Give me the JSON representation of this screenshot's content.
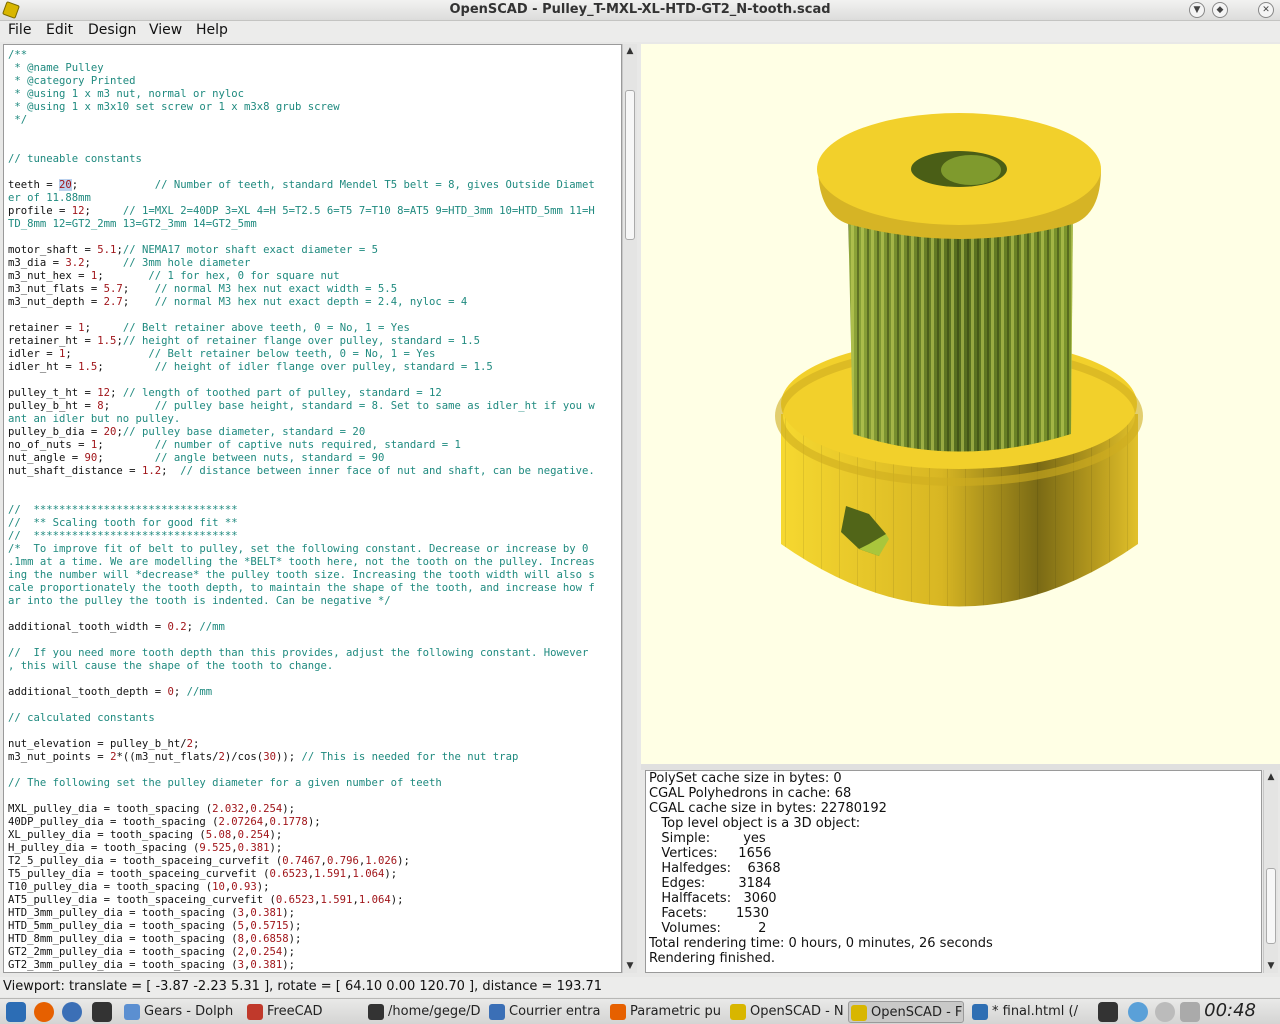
{
  "window": {
    "title": "OpenSCAD - Pulley_T-MXL-XL-HTD-GT2_N-tooth.scad"
  },
  "menu": [
    "File",
    "Edit",
    "Design",
    "View",
    "Help"
  ],
  "editor": {
    "lines": [
      [
        [
          "c",
          "/**"
        ]
      ],
      [
        [
          "c",
          " * @name Pulley"
        ]
      ],
      [
        [
          "c",
          " * @category Printed"
        ]
      ],
      [
        [
          "c",
          " * @using 1 x m3 nut, normal or nyloc"
        ]
      ],
      [
        [
          "c",
          " * @using 1 x m3x10 set screw or 1 x m3x8 grub screw"
        ]
      ],
      [
        [
          "c",
          " */"
        ]
      ],
      [],
      [],
      [
        [
          "c",
          "// tuneable constants"
        ]
      ],
      [],
      [
        [
          "t",
          "teeth = "
        ],
        [
          "s",
          "20"
        ],
        [
          "t",
          ";            "
        ],
        [
          "c",
          "// Number of teeth, standard Mendel T5 belt = 8, gives Outside Diamet"
        ]
      ],
      [
        [
          "c",
          "er of 11.88mm"
        ]
      ],
      [
        [
          "t",
          "profile = "
        ],
        [
          "n",
          "12"
        ],
        [
          "t",
          ";     "
        ],
        [
          "c",
          "// 1=MXL 2=40DP 3=XL 4=H 5=T2.5 6=T5 7=T10 8=AT5 9=HTD_3mm 10=HTD_5mm 11=H"
        ]
      ],
      [
        [
          "c",
          "TD_8mm 12=GT2_2mm 13=GT2_3mm 14=GT2_5mm"
        ]
      ],
      [],
      [
        [
          "t",
          "motor_shaft = "
        ],
        [
          "n",
          "5.1"
        ],
        [
          "t",
          ";"
        ],
        [
          "c",
          "// NEMA17 motor shaft exact diameter = 5"
        ]
      ],
      [
        [
          "t",
          "m3_dia = "
        ],
        [
          "n",
          "3.2"
        ],
        [
          "t",
          ";     "
        ],
        [
          "c",
          "// 3mm hole diameter"
        ]
      ],
      [
        [
          "t",
          "m3_nut_hex = "
        ],
        [
          "n",
          "1"
        ],
        [
          "t",
          ";       "
        ],
        [
          "c",
          "// 1 for hex, 0 for square nut"
        ]
      ],
      [
        [
          "t",
          "m3_nut_flats = "
        ],
        [
          "n",
          "5.7"
        ],
        [
          "t",
          ";    "
        ],
        [
          "c",
          "// normal M3 hex nut exact width = 5.5"
        ]
      ],
      [
        [
          "t",
          "m3_nut_depth = "
        ],
        [
          "n",
          "2.7"
        ],
        [
          "t",
          ";    "
        ],
        [
          "c",
          "// normal M3 hex nut exact depth = 2.4, nyloc = 4"
        ]
      ],
      [],
      [
        [
          "t",
          "retainer = "
        ],
        [
          "n",
          "1"
        ],
        [
          "t",
          ";     "
        ],
        [
          "c",
          "// Belt retainer above teeth, 0 = No, 1 = Yes"
        ]
      ],
      [
        [
          "t",
          "retainer_ht = "
        ],
        [
          "n",
          "1.5"
        ],
        [
          "t",
          ";"
        ],
        [
          "c",
          "// height of retainer flange over pulley, standard = 1.5"
        ]
      ],
      [
        [
          "t",
          "idler = "
        ],
        [
          "n",
          "1"
        ],
        [
          "t",
          ";            "
        ],
        [
          "c",
          "// Belt retainer below teeth, 0 = No, 1 = Yes"
        ]
      ],
      [
        [
          "t",
          "idler_ht = "
        ],
        [
          "n",
          "1.5"
        ],
        [
          "t",
          ";        "
        ],
        [
          "c",
          "// height of idler flange over pulley, standard = 1.5"
        ]
      ],
      [],
      [
        [
          "t",
          "pulley_t_ht = "
        ],
        [
          "n",
          "12"
        ],
        [
          "t",
          "; "
        ],
        [
          "c",
          "// length of toothed part of pulley, standard = 12"
        ]
      ],
      [
        [
          "t",
          "pulley_b_ht = "
        ],
        [
          "n",
          "8"
        ],
        [
          "t",
          ";       "
        ],
        [
          "c",
          "// pulley base height, standard = 8. Set to same as idler_ht if you w"
        ]
      ],
      [
        [
          "c",
          "ant an idler but no pulley."
        ]
      ],
      [
        [
          "t",
          "pulley_b_dia = "
        ],
        [
          "n",
          "20"
        ],
        [
          "t",
          ";"
        ],
        [
          "c",
          "// pulley base diameter, standard = 20"
        ]
      ],
      [
        [
          "t",
          "no_of_nuts = "
        ],
        [
          "n",
          "1"
        ],
        [
          "t",
          ";        "
        ],
        [
          "c",
          "// number of captive nuts required, standard = 1"
        ]
      ],
      [
        [
          "t",
          "nut_angle = "
        ],
        [
          "n",
          "90"
        ],
        [
          "t",
          ";        "
        ],
        [
          "c",
          "// angle between nuts, standard = 90"
        ]
      ],
      [
        [
          "t",
          "nut_shaft_distance = "
        ],
        [
          "n",
          "1.2"
        ],
        [
          "t",
          ";  "
        ],
        [
          "c",
          "// distance between inner face of nut and shaft, can be negative."
        ]
      ],
      [],
      [],
      [
        [
          "c",
          "//  ********************************"
        ]
      ],
      [
        [
          "c",
          "//  ** Scaling tooth for good fit **"
        ]
      ],
      [
        [
          "c",
          "//  ********************************"
        ]
      ],
      [
        [
          "c",
          "/*  To improve fit of belt to pulley, set the following constant. Decrease or increase by 0"
        ]
      ],
      [
        [
          "c",
          ".1mm at a time. We are modelling the *BELT* tooth here, not the tooth on the pulley. Increas"
        ]
      ],
      [
        [
          "c",
          "ing the number will *decrease* the pulley tooth size. Increasing the tooth width will also s"
        ]
      ],
      [
        [
          "c",
          "cale proportionately the tooth depth, to maintain the shape of the tooth, and increase how f"
        ]
      ],
      [
        [
          "c",
          "ar into the pulley the tooth is indented. Can be negative */"
        ]
      ],
      [],
      [
        [
          "t",
          "additional_tooth_width = "
        ],
        [
          "n",
          "0.2"
        ],
        [
          "t",
          "; "
        ],
        [
          "c",
          "//mm"
        ]
      ],
      [],
      [
        [
          "c",
          "//  If you need more tooth depth than this provides, adjust the following constant. However"
        ]
      ],
      [
        [
          "c",
          ", this will cause the shape of the tooth to change."
        ]
      ],
      [],
      [
        [
          "t",
          "additional_tooth_depth = "
        ],
        [
          "n",
          "0"
        ],
        [
          "t",
          "; "
        ],
        [
          "c",
          "//mm"
        ]
      ],
      [],
      [
        [
          "c",
          "// calculated constants"
        ]
      ],
      [],
      [
        [
          "t",
          "nut_elevation = pulley_b_ht/"
        ],
        [
          "n",
          "2"
        ],
        [
          "t",
          ";"
        ]
      ],
      [
        [
          "t",
          "m3_nut_points = "
        ],
        [
          "n",
          "2"
        ],
        [
          "t",
          "*((m3_nut_flats/"
        ],
        [
          "n",
          "2"
        ],
        [
          "t",
          ")/cos("
        ],
        [
          "n",
          "30"
        ],
        [
          "t",
          ")); "
        ],
        [
          "c",
          "// This is needed for the nut trap"
        ]
      ],
      [],
      [
        [
          "c",
          "// The following set the pulley diameter for a given number of teeth"
        ]
      ],
      [],
      [
        [
          "t",
          "MXL_pulley_dia = tooth_spacing ("
        ],
        [
          "n",
          "2.032"
        ],
        [
          "t",
          ","
        ],
        [
          "n",
          "0.254"
        ],
        [
          "t",
          ");"
        ]
      ],
      [
        [
          "t",
          "40DP_pulley_dia = tooth_spacing ("
        ],
        [
          "n",
          "2.07264"
        ],
        [
          "t",
          ","
        ],
        [
          "n",
          "0.1778"
        ],
        [
          "t",
          ");"
        ]
      ],
      [
        [
          "t",
          "XL_pulley_dia = tooth_spacing ("
        ],
        [
          "n",
          "5.08"
        ],
        [
          "t",
          ","
        ],
        [
          "n",
          "0.254"
        ],
        [
          "t",
          ");"
        ]
      ],
      [
        [
          "t",
          "H_pulley_dia = tooth_spacing ("
        ],
        [
          "n",
          "9.525"
        ],
        [
          "t",
          ","
        ],
        [
          "n",
          "0.381"
        ],
        [
          "t",
          ");"
        ]
      ],
      [
        [
          "t",
          "T2_5_pulley_dia = tooth_spaceing_curvefit ("
        ],
        [
          "n",
          "0.7467"
        ],
        [
          "t",
          ","
        ],
        [
          "n",
          "0.796"
        ],
        [
          "t",
          ","
        ],
        [
          "n",
          "1.026"
        ],
        [
          "t",
          ");"
        ]
      ],
      [
        [
          "t",
          "T5_pulley_dia = tooth_spaceing_curvefit ("
        ],
        [
          "n",
          "0.6523"
        ],
        [
          "t",
          ","
        ],
        [
          "n",
          "1.591"
        ],
        [
          "t",
          ","
        ],
        [
          "n",
          "1.064"
        ],
        [
          "t",
          ");"
        ]
      ],
      [
        [
          "t",
          "T10_pulley_dia = tooth_spacing ("
        ],
        [
          "n",
          "10"
        ],
        [
          "t",
          ","
        ],
        [
          "n",
          "0.93"
        ],
        [
          "t",
          ");"
        ]
      ],
      [
        [
          "t",
          "AT5_pulley_dia = tooth_spaceing_curvefit ("
        ],
        [
          "n",
          "0.6523"
        ],
        [
          "t",
          ","
        ],
        [
          "n",
          "1.591"
        ],
        [
          "t",
          ","
        ],
        [
          "n",
          "1.064"
        ],
        [
          "t",
          ");"
        ]
      ],
      [
        [
          "t",
          "HTD_3mm_pulley_dia = tooth_spacing ("
        ],
        [
          "n",
          "3"
        ],
        [
          "t",
          ","
        ],
        [
          "n",
          "0.381"
        ],
        [
          "t",
          ");"
        ]
      ],
      [
        [
          "t",
          "HTD_5mm_pulley_dia = tooth_spacing ("
        ],
        [
          "n",
          "5"
        ],
        [
          "t",
          ","
        ],
        [
          "n",
          "0.5715"
        ],
        [
          "t",
          ");"
        ]
      ],
      [
        [
          "t",
          "HTD_8mm_pulley_dia = tooth_spacing ("
        ],
        [
          "n",
          "8"
        ],
        [
          "t",
          ","
        ],
        [
          "n",
          "0.6858"
        ],
        [
          "t",
          ");"
        ]
      ],
      [
        [
          "t",
          "GT2_2mm_pulley_dia = tooth_spacing ("
        ],
        [
          "n",
          "2"
        ],
        [
          "t",
          ","
        ],
        [
          "n",
          "0.254"
        ],
        [
          "t",
          ");"
        ]
      ],
      [
        [
          "t",
          "GT2_3mm_pulley_dia = tooth_spacing ("
        ],
        [
          "n",
          "3"
        ],
        [
          "t",
          ","
        ],
        [
          "n",
          "0.381"
        ],
        [
          "t",
          ");"
        ]
      ]
    ]
  },
  "console": {
    "lines": [
      "PolySet cache size in bytes: 0",
      "CGAL Polyhedrons in cache: 68",
      "CGAL cache size in bytes: 22780192",
      "   Top level object is a 3D object:",
      "   Simple:        yes",
      "   Vertices:     1656",
      "   Halfedges:    6368",
      "   Edges:        3184",
      "   Halffacets:   3060",
      "   Facets:       1530",
      "   Volumes:         2",
      "Total rendering time: 0 hours, 0 minutes, 26 seconds",
      "Rendering finished."
    ]
  },
  "status": {
    "viewport": "Viewport: translate = [ -3.87 -2.23 5.31 ], rotate = [ 64.10 0.00 120.70 ], distance = 193.71"
  },
  "taskbar": {
    "tasks": [
      {
        "label": "Gears - Dolph",
        "icon": "folder-icon",
        "color": "#5b8fd1"
      },
      {
        "label": "FreeCAD",
        "icon": "freecad-icon",
        "color": "#c0392b"
      },
      {
        "label": "/home/gege/D",
        "icon": "terminal-icon",
        "color": "#333333"
      },
      {
        "label": "Courrier entra",
        "icon": "mail-icon",
        "color": "#3b6fb6"
      },
      {
        "label": "Parametric pu",
        "icon": "firefox-icon",
        "color": "#e66000"
      },
      {
        "label": "OpenSCAD - N",
        "icon": "openscad-icon",
        "color": "#d8b600"
      },
      {
        "label": "OpenSCAD - F",
        "icon": "openscad-icon",
        "color": "#d8b600",
        "active": true
      },
      {
        "label": "* final.html (/",
        "icon": "editor-icon",
        "color": "#2f6fb3"
      }
    ],
    "clock": "00:48"
  },
  "colors": {
    "viewport_bg": "#ffffe5",
    "pulley_yellow": "#f2d02b",
    "teeth_green": "#6f8f2a",
    "comment": "#1f8a7f",
    "number": "#a0151a"
  }
}
